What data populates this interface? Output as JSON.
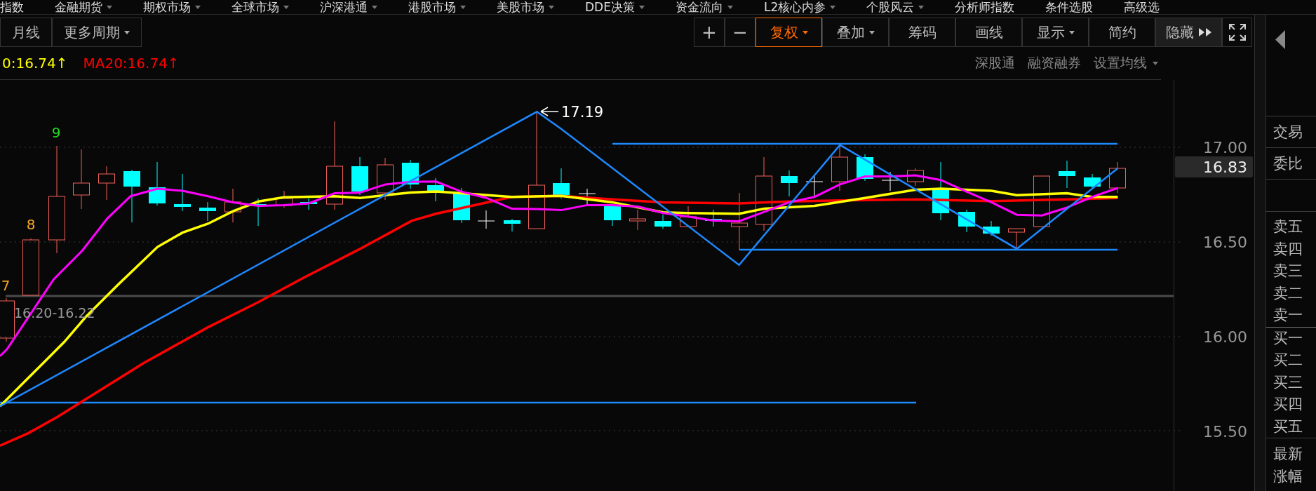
{
  "menu": [
    {
      "label": "指数",
      "caret": false
    },
    {
      "label": "金融期货",
      "caret": true
    },
    {
      "label": "期权市场",
      "caret": true
    },
    {
      "label": "全球市场",
      "caret": true
    },
    {
      "label": "沪深港通",
      "caret": true
    },
    {
      "label": "港股市场",
      "caret": true
    },
    {
      "label": "美股市场",
      "caret": true
    },
    {
      "label": "DDE决策",
      "caret": true
    },
    {
      "label": "资金流向",
      "caret": true
    },
    {
      "label": "L2核心内参",
      "caret": true
    },
    {
      "label": "个股风云",
      "caret": true
    },
    {
      "label": "分析师指数",
      "caret": false
    },
    {
      "label": "条件选股",
      "caret": false
    },
    {
      "label": "高级选",
      "caret": false
    }
  ],
  "period_buttons": [
    {
      "label": "月线",
      "dropdown": false
    },
    {
      "label": "更多周期",
      "dropdown": true
    }
  ],
  "tool_buttons": [
    {
      "kind": "sign",
      "label": "+",
      "selected": false,
      "dropdown": false
    },
    {
      "kind": "sign",
      "label": "−",
      "selected": false,
      "dropdown": false
    },
    {
      "kind": "text",
      "label": "复权",
      "selected": true,
      "dropdown": true
    },
    {
      "kind": "text",
      "label": "叠加",
      "selected": false,
      "dropdown": true
    },
    {
      "kind": "text",
      "label": "筹码",
      "selected": false,
      "dropdown": false
    },
    {
      "kind": "text",
      "label": "画线",
      "selected": false,
      "dropdown": false
    },
    {
      "kind": "text",
      "label": "显示",
      "selected": false,
      "dropdown": true
    },
    {
      "kind": "text",
      "label": "简约",
      "selected": false,
      "dropdown": false
    },
    {
      "kind": "hide",
      "label": "隐藏",
      "selected": false
    },
    {
      "kind": "fullscreen",
      "selected": false
    }
  ],
  "ma_legend": [
    {
      "text": "0:16.74↑",
      "color": "#ffff00"
    },
    {
      "text": "MA20:16.74↑",
      "color": "#ff0000"
    }
  ],
  "chart_links": [
    {
      "label": "深股通",
      "dropdown": false
    },
    {
      "label": "融资融券",
      "dropdown": false
    },
    {
      "label": "设置均线",
      "dropdown": true
    }
  ],
  "chart": {
    "counts": [
      {
        "text": "7",
        "color": "#f5a623"
      },
      {
        "text": "8",
        "color": "#f5a623"
      },
      {
        "text": "9",
        "color": "#22e022"
      }
    ],
    "high_label": "17.19",
    "range_label": "16.20-16.22",
    "y_axis_labels": [
      "17.00",
      "16.50",
      "16.00",
      "15.50"
    ],
    "current_price": "16.83"
  },
  "panel": {
    "rows": [
      "交易",
      "委比"
    ],
    "asks": [
      "卖五",
      "卖四",
      "卖三",
      "卖二",
      "卖一"
    ],
    "bids": [
      "买一",
      "买二",
      "买三",
      "买四",
      "买五"
    ],
    "quote": [
      "最新",
      "涨幅"
    ]
  }
}
